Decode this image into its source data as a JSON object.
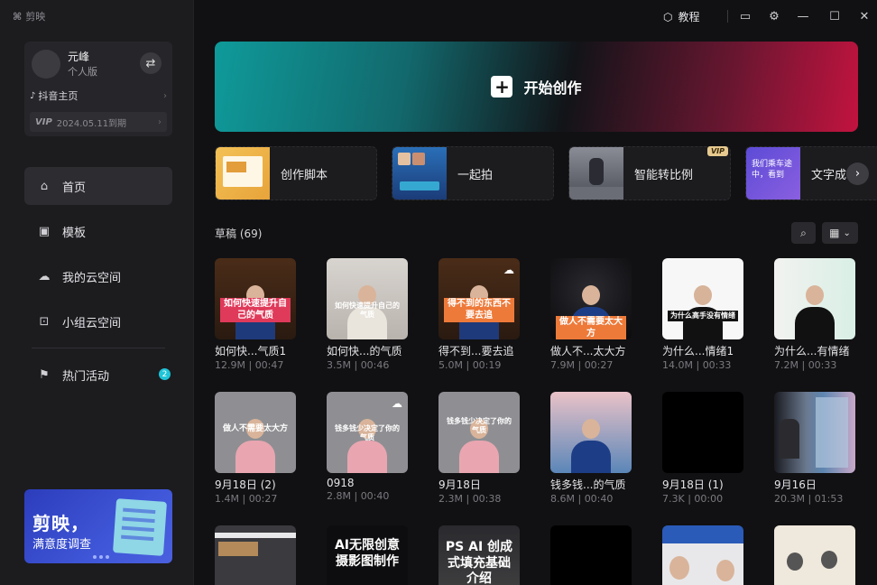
{
  "app": {
    "name": "剪映",
    "logo_icon": "capcut-logo-icon"
  },
  "user": {
    "name": "元峰",
    "edition": "个人版",
    "douyin_label": "抖音主页",
    "vip_badge": "VIP",
    "vip_expiry": "2024.05.11到期"
  },
  "nav": {
    "items": [
      {
        "label": "首页",
        "icon": "home-icon",
        "active": true
      },
      {
        "label": "模板",
        "icon": "template-icon"
      },
      {
        "label": "我的云空间",
        "icon": "cloud-icon"
      },
      {
        "label": "小组云空间",
        "icon": "team-cloud-icon"
      }
    ],
    "events": {
      "label": "热门活动",
      "icon": "flag-icon",
      "badge": "2"
    }
  },
  "survey": {
    "line1": "剪映，",
    "line2": "满意度调查"
  },
  "titlebar": {
    "tutorial": "教程"
  },
  "hero": {
    "label": "开始创作"
  },
  "tools": [
    {
      "name": "创作脚本",
      "vip": false
    },
    {
      "name": "一起拍",
      "vip": false
    },
    {
      "name": "智能转比例",
      "vip": true,
      "vip_label": "VIP"
    },
    {
      "name": "文字成",
      "vip": false
    }
  ],
  "tool_thumbs": {
    "t4_text": "我们乘车途中，看到"
  },
  "drafts": {
    "title": "草稿 (69)",
    "items": [
      {
        "title": "如何快...气质1",
        "size": "12.9M",
        "duration": "00:47",
        "caption": "如何快速提升自己的气质",
        "cloud": false
      },
      {
        "title": "如何快...的气质",
        "size": "3.5M",
        "duration": "00:46",
        "caption": "如何快速提升自己的气质",
        "cloud": false
      },
      {
        "title": "得不到...要去追",
        "size": "5.0M",
        "duration": "00:19",
        "caption": "得不到的东西不要去追",
        "cloud": true
      },
      {
        "title": "做人不...太大方",
        "size": "7.9M",
        "duration": "00:27",
        "caption": "做人不需要太大方",
        "cloud": false
      },
      {
        "title": "为什么...情绪1",
        "size": "14.0M",
        "duration": "00:33",
        "caption": "为什么高手没有情绪",
        "cloud": false
      },
      {
        "title": "为什么...有情绪",
        "size": "7.2M",
        "duration": "00:33",
        "caption": "",
        "cloud": false
      },
      {
        "title": "9月18日 (2)",
        "size": "1.4M",
        "duration": "00:27",
        "caption": "做人不需要太大方",
        "cloud": false
      },
      {
        "title": "0918",
        "size": "2.8M",
        "duration": "00:40",
        "caption": "钱多钱少决定了你的气质",
        "cloud": true
      },
      {
        "title": "9月18日",
        "size": "2.3M",
        "duration": "00:38",
        "caption": "钱多钱少决定了你的气质",
        "cloud": false
      },
      {
        "title": "钱多钱...的气质",
        "size": "8.6M",
        "duration": "00:40",
        "caption": "",
        "cloud": false
      },
      {
        "title": "9月18日 (1)",
        "size": "7.3K",
        "duration": "00:00",
        "caption": "",
        "cloud": false
      },
      {
        "title": "9月16日",
        "size": "20.3M",
        "duration": "01:53",
        "caption": "",
        "cloud": false
      },
      {
        "title": "",
        "size": "",
        "duration": "",
        "caption": "",
        "cloud": false
      },
      {
        "title": "",
        "size": "",
        "duration": "",
        "caption": "AI无限创意摄影图制作",
        "cloud": false
      },
      {
        "title": "",
        "size": "",
        "duration": "",
        "caption": "PS AI 创成式填充基础介绍",
        "cloud": false
      },
      {
        "title": "",
        "size": "",
        "duration": "",
        "caption": "",
        "cloud": false
      },
      {
        "title": "",
        "size": "",
        "duration": "",
        "caption": "",
        "cloud": false
      },
      {
        "title": "",
        "size": "",
        "duration": "",
        "caption": "",
        "cloud": false
      }
    ]
  },
  "colors": {
    "accent": "#1fc5d8",
    "sidebar_bg": "#1c1c1f",
    "main_bg": "#111113"
  }
}
